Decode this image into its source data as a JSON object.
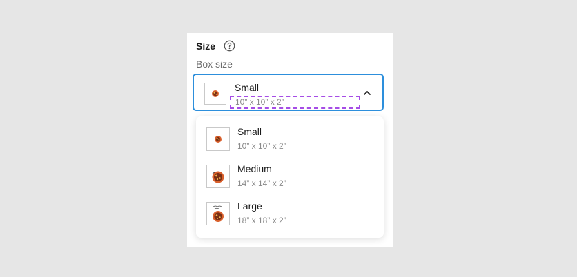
{
  "size_section": {
    "title": "Size",
    "help_icon": "question-circle-icon"
  },
  "box_size": {
    "label": "Box size",
    "selected": {
      "name": "Small",
      "dimensions": "10” x 10” x 2”",
      "thumbnail_icon": "pizza-box-small-thumbnail"
    },
    "expanded": true,
    "chevron_icon": "chevron-up-icon",
    "options": [
      {
        "name": "Small",
        "dimensions": "10” x 10” x 2”",
        "thumbnail_icon": "pizza-box-small-thumbnail"
      },
      {
        "name": "Medium",
        "dimensions": "14” x 14” x 2”",
        "thumbnail_icon": "pizza-box-medium-thumbnail"
      },
      {
        "name": "Large",
        "dimensions": "18” x 18” x 2”",
        "thumbnail_icon": "pizza-box-large-thumbnail"
      }
    ]
  },
  "colors": {
    "focus_border": "#2d8fdc",
    "highlight_dashed": "#a64de6",
    "background": "#e6e6e6"
  }
}
